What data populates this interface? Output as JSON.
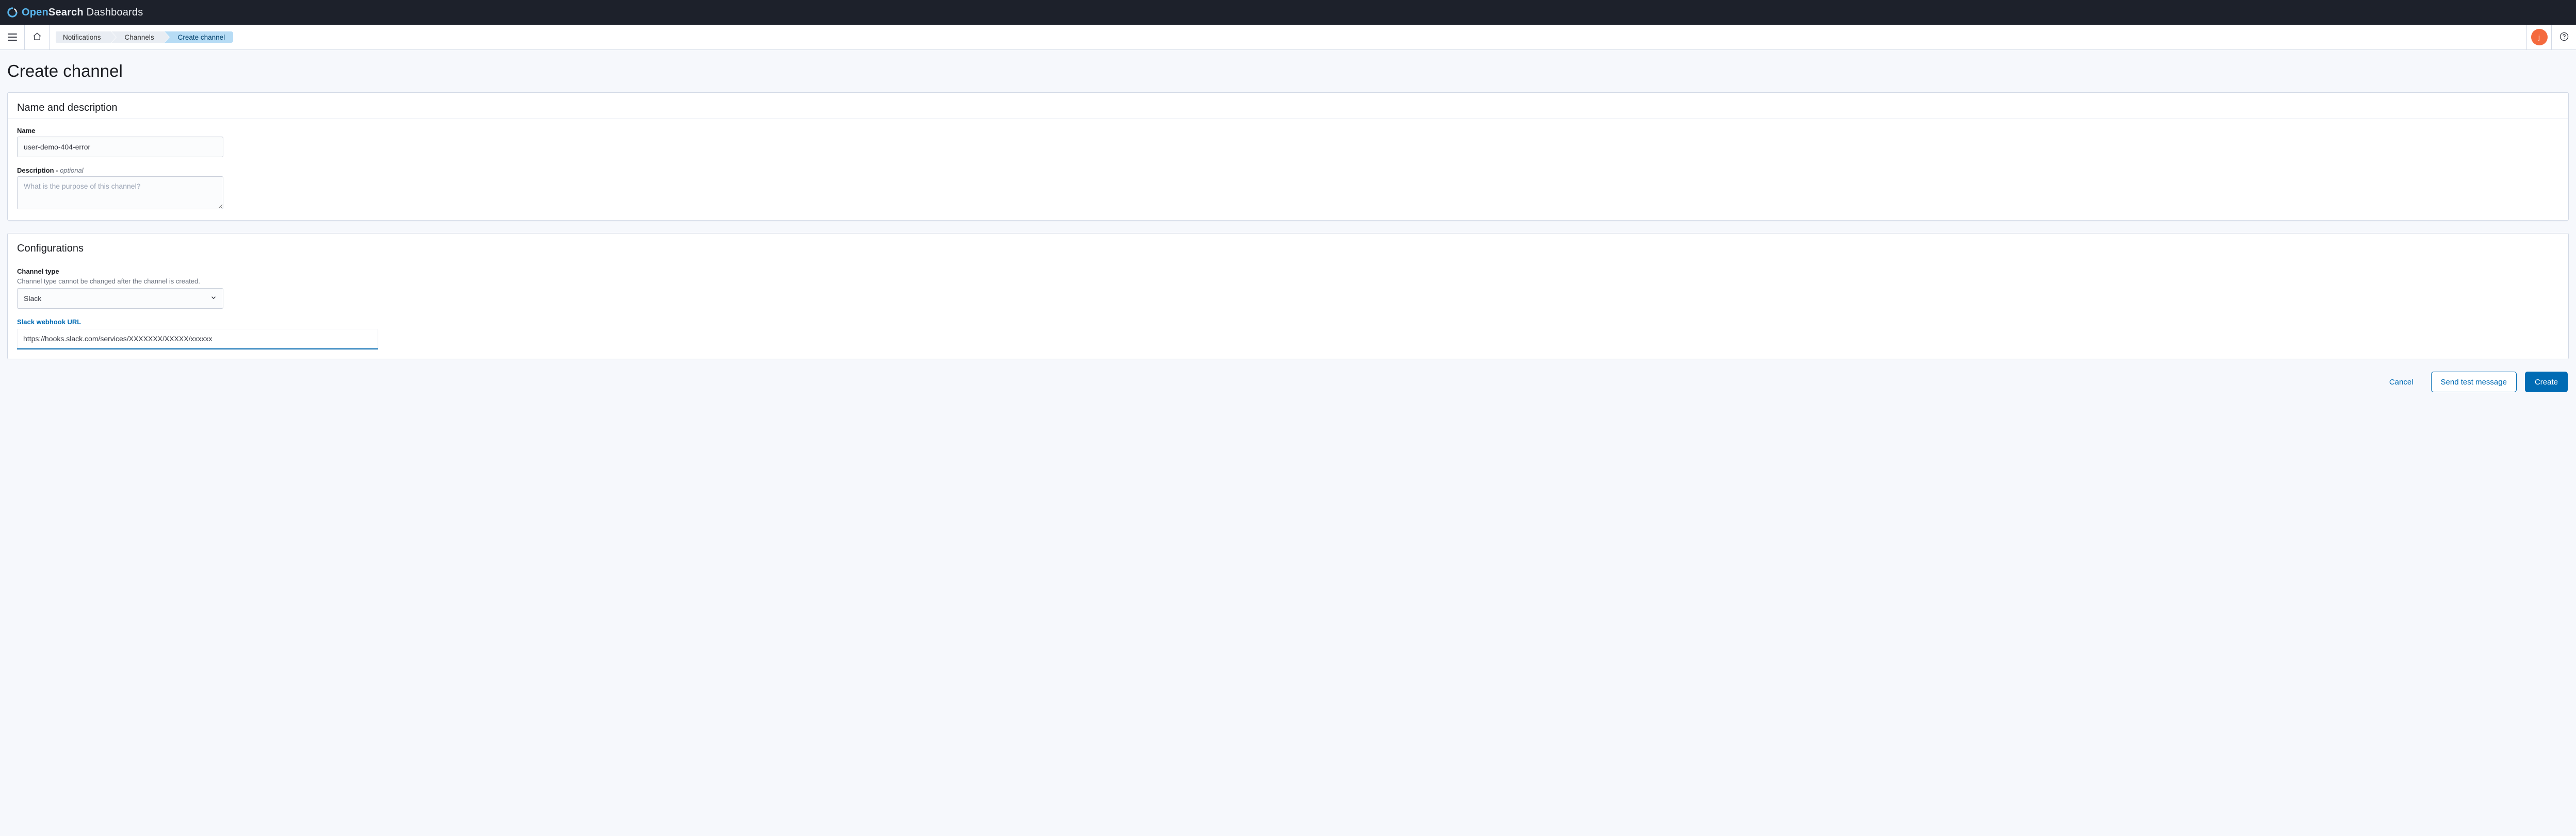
{
  "brand": {
    "open": "Open",
    "search": "Search",
    "dashboards": " Dashboards"
  },
  "breadcrumbs": [
    {
      "label": "Notifications"
    },
    {
      "label": "Channels"
    },
    {
      "label": "Create channel"
    }
  ],
  "user": {
    "initial": "j"
  },
  "page": {
    "title": "Create channel"
  },
  "section_name_desc": {
    "heading": "Name and description",
    "name_label": "Name",
    "name_value": "user-demo-404-error",
    "desc_label": "Description - ",
    "desc_optional": "optional",
    "desc_placeholder": "What is the purpose of this channel?",
    "desc_value": ""
  },
  "section_config": {
    "heading": "Configurations",
    "type_label": "Channel type",
    "type_hint": "Channel type cannot be changed after the channel is created.",
    "type_value": "Slack",
    "webhook_label": "Slack webhook URL",
    "webhook_value": "https://hooks.slack.com/services/XXXXXXX/XXXXX/xxxxxx"
  },
  "footer": {
    "cancel": "Cancel",
    "send_test": "Send test message",
    "create": "Create"
  }
}
